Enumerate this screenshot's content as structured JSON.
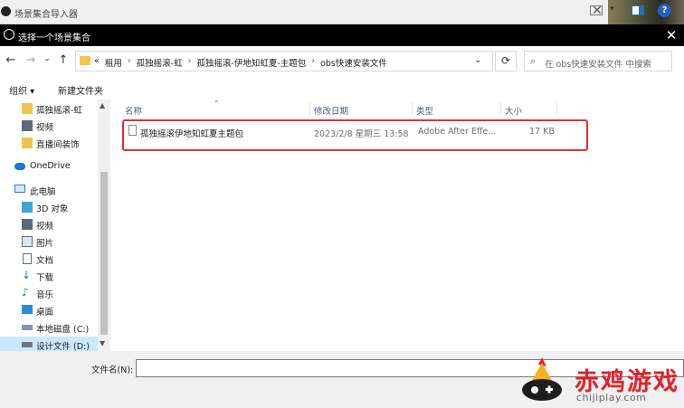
{
  "background_window": {
    "title": "场景集合导入器"
  },
  "dialog": {
    "title": "选择一个场景集合",
    "close": "✕"
  },
  "nav_buttons": {
    "back": "←",
    "forward": "→",
    "recent": "⌄",
    "up": "↑"
  },
  "address": {
    "prefix": "«",
    "crumbs": [
      "租用",
      "孤独摇滚-虹",
      "孤独摇滚-伊地知虹夏-主题包",
      "obs快速安装文件"
    ],
    "separator": "›"
  },
  "search": {
    "placeholder": "在 obs快速安装文件 中搜索"
  },
  "toolbar": {
    "organize": "组织 ▾",
    "new_folder": "新建文件夹"
  },
  "nav_pane": {
    "items": [
      {
        "label": "孤独摇滚-虹",
        "icon": "folder-icon"
      },
      {
        "label": "视频",
        "icon": "video-folder-icon"
      },
      {
        "label": "直播间装饰",
        "icon": "folder-icon"
      },
      {
        "label": "OneDrive",
        "icon": "cloud-icon"
      },
      {
        "label": "此电脑",
        "icon": "computer-icon"
      },
      {
        "label": "3D 对象",
        "icon": "cube-icon"
      },
      {
        "label": "视频",
        "icon": "video-folder-icon"
      },
      {
        "label": "图片",
        "icon": "pictures-icon"
      },
      {
        "label": "文档",
        "icon": "documents-icon"
      },
      {
        "label": "下载",
        "icon": "download-icon"
      },
      {
        "label": "音乐",
        "icon": "music-icon"
      },
      {
        "label": "桌面",
        "icon": "desktop-icon"
      },
      {
        "label": "本地磁盘 (C:)",
        "icon": "drive-icon"
      },
      {
        "label": "设计文件 (D:)",
        "icon": "drive-icon"
      }
    ]
  },
  "columns": {
    "name": "名称",
    "modified": "修改日期",
    "type": "类型",
    "size": "大小"
  },
  "files": [
    {
      "name": "孤独摇滚伊地知虹夏主题包",
      "modified": "2023/2/8 星期三 13:58",
      "type": "Adobe After Effe...",
      "size": "17 KB"
    }
  ],
  "bottom": {
    "filename_label": "文件名(N):",
    "filename_value": ""
  },
  "watermark": {
    "brand": "赤鸡游戏",
    "url": "chijiplay.com"
  },
  "colors": {
    "highlight_box": "#e03131",
    "selected_nav": "#cce8ff",
    "brand_red": "#e2202c"
  }
}
